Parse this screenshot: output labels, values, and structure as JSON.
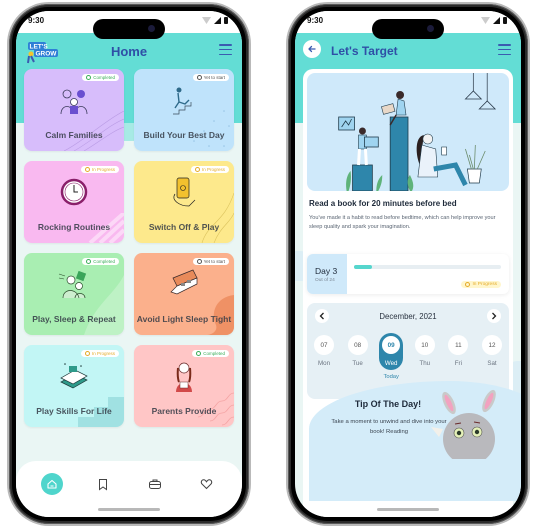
{
  "status_bar": {
    "time": "9:30"
  },
  "home_screen": {
    "header": {
      "title": "Home",
      "logo": "lets-grow-logo",
      "menu_icon": "hamburger-menu-icon"
    },
    "cards": [
      {
        "title": "Calm Families",
        "status": "Completed",
        "status_icon": "check-circle-icon",
        "bg": "#d7bdfb",
        "illustration": "family-icon"
      },
      {
        "title": "Build Your Best Day",
        "status": "Yet to start",
        "status_icon": "hourglass-icon",
        "bg": "#bfe3fb",
        "illustration": "climbing-stairs-icon"
      },
      {
        "title": "Rocking Routines",
        "status": "In Progress",
        "status_icon": "clock-icon",
        "bg": "#f9b9f0",
        "illustration": "wall-clock-icon"
      },
      {
        "title": "Switch Off & Play",
        "status": "In Progress",
        "status_icon": "clock-icon",
        "bg": "#fde98c",
        "illustration": "phone-power-icon"
      },
      {
        "title": "Play, Sleep & Repeat",
        "status": "Completed",
        "status_icon": "check-circle-icon",
        "bg": "#a9eeb2",
        "illustration": "kids-playing-icon"
      },
      {
        "title": "Avoid Light Sleep Tight",
        "status": "Yet to start",
        "status_icon": "hourglass-icon",
        "bg": "#fbb08c",
        "illustration": "bed-icon"
      },
      {
        "title": "Play Skills For Life",
        "status": "In Progress",
        "status_icon": "clock-icon",
        "bg": "#c2f6f5",
        "illustration": "toys-icon"
      },
      {
        "title": "Parents Provide",
        "status": "Completed",
        "status_icon": "check-circle-icon",
        "bg": "#ffc6c6",
        "illustration": "parent-reading-icon"
      }
    ],
    "bottom_nav": [
      {
        "name": "home",
        "icon": "home-icon",
        "active": true
      },
      {
        "name": "bookmarks",
        "icon": "bookmark-icon",
        "active": false
      },
      {
        "name": "toolkit",
        "icon": "briefcase-icon",
        "active": false
      },
      {
        "name": "favorites",
        "icon": "heart-icon",
        "active": false
      }
    ]
  },
  "target_screen": {
    "header": {
      "title": "Let's Target",
      "back_icon": "arrow-left-icon",
      "menu_icon": "hamburger-menu-icon"
    },
    "task": {
      "title": "Read a book for 20 minutes before bed",
      "description": "You've made it a habit to read before bedtime, which can help improve your sleep quality and spark your imagination."
    },
    "progress": {
      "day_label": "Day 3",
      "out_of": "Out of 24",
      "current": 3,
      "total": 24,
      "status": "In Progress"
    },
    "calendar": {
      "month": "December, 2021",
      "prev_icon": "chevron-left-icon",
      "next_icon": "chevron-right-icon",
      "days": [
        {
          "date": "07",
          "weekday": "Mon"
        },
        {
          "date": "08",
          "weekday": "Tue"
        },
        {
          "date": "09",
          "weekday": "Wed",
          "selected": true
        },
        {
          "date": "10",
          "weekday": "Thu"
        },
        {
          "date": "11",
          "weekday": "Fri"
        },
        {
          "date": "12",
          "weekday": "Sat"
        }
      ],
      "today_label": "Today"
    },
    "tip": {
      "title": "Tip Of The Day!",
      "text": "Take a moment to unwind and dive into your book! Reading"
    }
  },
  "colors": {
    "header_teal": "#63ddd5",
    "title_blue": "#2f4fa6",
    "accent_blue": "#2e86ab",
    "progress_teal": "#56d6cd"
  }
}
